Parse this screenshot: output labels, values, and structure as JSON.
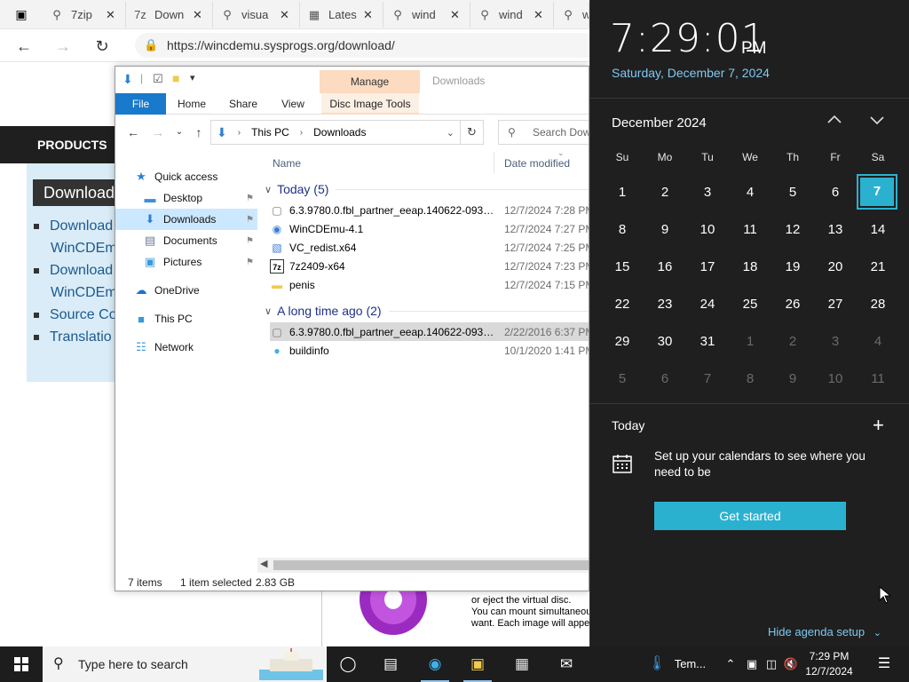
{
  "browser": {
    "tabs": [
      {
        "icon": "search-icon",
        "glyph": "⚲",
        "title": "7zip"
      },
      {
        "icon": "7zip-icon",
        "glyph": "7z",
        "title": "Down"
      },
      {
        "icon": "search-icon",
        "glyph": "⚲",
        "title": "visua"
      },
      {
        "icon": "microsoft-icon",
        "glyph": "▦",
        "title": "Lates"
      },
      {
        "icon": "search-icon",
        "glyph": "⚲",
        "title": "wind"
      },
      {
        "icon": "search-icon",
        "glyph": "⚲",
        "title": "wind"
      },
      {
        "icon": "search-icon",
        "glyph": "⚲",
        "title": "w"
      }
    ],
    "url": "https://wincdemu.sysprogs.org/download/",
    "page": {
      "nav_products": "PRODUCTS",
      "download_heading": "Download",
      "links": [
        {
          "line1": "Download",
          "line2": "WinCDEm"
        },
        {
          "line1": "Download",
          "line2": "WinCDEm"
        },
        {
          "line1": "Source Co",
          "line2": ""
        },
        {
          "line1": "Translatio",
          "line2": ""
        }
      ],
      "info_lines": [
        "or eject the virtual disc.",
        "You can mount simultaneous",
        "want. Each image will appea"
      ]
    }
  },
  "explorer": {
    "title": "Downloads",
    "manage_tab": "Manage",
    "ribbon_tabs": [
      "File",
      "Home",
      "Share",
      "View",
      "Disc Image Tools"
    ],
    "breadcrumb": [
      "This PC",
      "Downloads"
    ],
    "search_placeholder": "Search Dow",
    "columns": {
      "name": "Name",
      "date": "Date modified"
    },
    "nav": [
      {
        "label": "Quick access",
        "icon": "star-icon",
        "glyph": "★",
        "color": "#2f7fd3",
        "pinned": false,
        "selected": false
      },
      {
        "label": "Desktop",
        "icon": "desktop-icon",
        "glyph": "▬",
        "color": "#3b8fd9",
        "pinned": true,
        "selected": false
      },
      {
        "label": "Downloads",
        "icon": "download-icon",
        "glyph": "⬇",
        "color": "#2f7fd3",
        "pinned": true,
        "selected": true
      },
      {
        "label": "Documents",
        "icon": "documents-icon",
        "glyph": "▤",
        "color": "#6b7d95",
        "pinned": true,
        "selected": false
      },
      {
        "label": "Pictures",
        "icon": "pictures-icon",
        "glyph": "▣",
        "color": "#3a9ad9",
        "pinned": true,
        "selected": false
      },
      {
        "label": "OneDrive",
        "icon": "cloud-icon",
        "glyph": "☁",
        "color": "#1a73d0",
        "pinned": false,
        "selected": false
      },
      {
        "label": "This PC",
        "icon": "computer-icon",
        "glyph": "■",
        "color": "#3a9ad9",
        "pinned": false,
        "selected": false
      },
      {
        "label": "Network",
        "icon": "network-icon",
        "glyph": "☷",
        "color": "#3a9ad9",
        "pinned": false,
        "selected": false
      }
    ],
    "groups": [
      {
        "label": "Today (5)",
        "files": [
          {
            "name": "6.3.9780.0.fbl_partner_eeap.140622-0937_...",
            "date": "12/7/2024 7:28 PM",
            "icon": "disc-image-icon",
            "glyph": "▢",
            "selected": false
          },
          {
            "name": "WinCDEmu-4.1",
            "date": "12/7/2024 7:27 PM",
            "icon": "installer-icon",
            "glyph": "◉",
            "selected": false
          },
          {
            "name": "VC_redist.x64",
            "date": "12/7/2024 7:25 PM",
            "icon": "installer-icon",
            "glyph": "▧",
            "selected": false
          },
          {
            "name": "7z2409-x64",
            "date": "12/7/2024 7:23 PM",
            "icon": "7zip-icon",
            "glyph": "7z",
            "selected": false
          },
          {
            "name": "penis",
            "date": "12/7/2024 7:15 PM",
            "icon": "folder-icon",
            "glyph": "▬",
            "selected": false
          }
        ]
      },
      {
        "label": "A long time ago (2)",
        "files": [
          {
            "name": "6.3.9780.0.fbl_partner_eeap.140622-0937_...",
            "date": "2/22/2016 6:37 PM",
            "icon": "disc-image-icon",
            "glyph": "▢",
            "selected": true
          },
          {
            "name": "buildinfo",
            "date": "10/1/2020 1:41 PM",
            "icon": "edge-file-icon",
            "glyph": "●",
            "selected": false
          }
        ]
      }
    ],
    "status": {
      "items": "7 items",
      "selected": "1 item selected",
      "size": "2.83 GB"
    }
  },
  "calendar": {
    "time": "7:29:01",
    "ampm": "PM",
    "date_long": "Saturday, December 7, 2024",
    "month_label": "December 2024",
    "weekdays": [
      "Su",
      "Mo",
      "Tu",
      "We",
      "Th",
      "Fr",
      "Sa"
    ],
    "weeks": [
      [
        {
          "d": "1"
        },
        {
          "d": "2"
        },
        {
          "d": "3"
        },
        {
          "d": "4"
        },
        {
          "d": "5"
        },
        {
          "d": "6"
        },
        {
          "d": "7",
          "today": true
        }
      ],
      [
        {
          "d": "8"
        },
        {
          "d": "9"
        },
        {
          "d": "10"
        },
        {
          "d": "11"
        },
        {
          "d": "12"
        },
        {
          "d": "13"
        },
        {
          "d": "14"
        }
      ],
      [
        {
          "d": "15"
        },
        {
          "d": "16"
        },
        {
          "d": "17"
        },
        {
          "d": "18"
        },
        {
          "d": "19"
        },
        {
          "d": "20"
        },
        {
          "d": "21"
        }
      ],
      [
        {
          "d": "22"
        },
        {
          "d": "23"
        },
        {
          "d": "24"
        },
        {
          "d": "25"
        },
        {
          "d": "26"
        },
        {
          "d": "27"
        },
        {
          "d": "28"
        }
      ],
      [
        {
          "d": "29"
        },
        {
          "d": "30"
        },
        {
          "d": "31"
        },
        {
          "d": "1",
          "dim": true
        },
        {
          "d": "2",
          "dim": true
        },
        {
          "d": "3",
          "dim": true
        },
        {
          "d": "4",
          "dim": true
        }
      ],
      [
        {
          "d": "5",
          "dim": true
        },
        {
          "d": "6",
          "dim": true
        },
        {
          "d": "7",
          "dim": true
        },
        {
          "d": "8",
          "dim": true
        },
        {
          "d": "9",
          "dim": true
        },
        {
          "d": "10",
          "dim": true
        },
        {
          "d": "11",
          "dim": true
        }
      ]
    ],
    "today_label": "Today",
    "setup_text": "Set up your calendars to see where you need to be",
    "get_started": "Get started",
    "hide_agenda": "Hide agenda setup"
  },
  "taskbar": {
    "search_placeholder": "Type here to search",
    "weather_text": "Tem...",
    "time": "7:29 PM",
    "date": "12/7/2024"
  },
  "colors": {
    "accent": "#2bb1d0",
    "link_blue": "#7ec8f2",
    "flyout_bg": "#1f1f1f",
    "taskbar_bg": "#1d1d1d",
    "ribbon_file": "#1979ca",
    "manage_tab": "#fcdbc0"
  }
}
